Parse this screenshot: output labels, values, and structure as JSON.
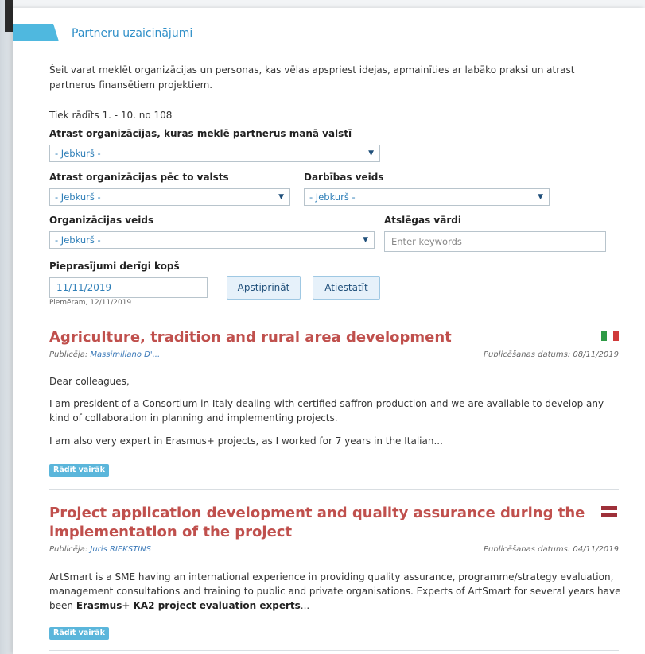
{
  "header": {
    "title": "Partneru uzaicinājumi"
  },
  "intro": "Šeit varat meklēt organizācijas un personas, kas vēlas apspriest idejas, apmainīties ar labāko praksi un atrast partnerus finansētiem projektiem.",
  "count_text": "Tiek rādīts 1. - 10. no 108",
  "filters": {
    "country_partner_label": "Atrast organizācijas, kuras meklē partnerus manā valstī",
    "country_partner_value": "- Jebkurš -",
    "country_label": "Atrast organizācijas pēc to valsts",
    "country_value": "- Jebkurš -",
    "activity_label": "Darbības veids",
    "activity_value": "- Jebkurš -",
    "org_type_label": "Organizācijas veids",
    "org_type_value": "- Jebkurš -",
    "keywords_label": "Atslēgas vārdi",
    "keywords_placeholder": "Enter keywords",
    "valid_since_label": "Pieprasījumi derīgi kopš",
    "valid_since_value": "11/11/2019",
    "date_hint": "Piemēram, 12/11/2019",
    "apply_label": "Apstiprināt",
    "reset_label": "Atiestatīt"
  },
  "posts": [
    {
      "title": "Agriculture, tradition and rural area development",
      "publisher_label": "Publicēja:",
      "publisher": "Massimiliano D'...",
      "date_label": "Publicēšanas datums: 08/11/2019",
      "flag": "italy-flag",
      "p1": "Dear colleagues,",
      "p2": "I am president of a Consortium in Italy dealing with certified saffron production and we are available to develop any kind of collaboration in planning and implementing projects.",
      "p3": "I am also very expert in Erasmus+ projects, as I worked for 7 years in the Italian...",
      "more_label": "Rādīt vairāk"
    },
    {
      "title": "Project application development and quality assurance during the implementation of the project",
      "publisher_label": "Publicēja:",
      "publisher": "Juris RIEKSTINS",
      "date_label": "Publicēšanas datums: 04/11/2019",
      "flag": "latvia-flag",
      "p1_start": "ArtSmart is a SME having an international experience in providing quality assurance, programme/strategy evaluation, management consultations and training to public and private organisations. Experts of ArtSmart for several years have been ",
      "p1_bold": "Erasmus+ KA2 project evaluation experts",
      "p1_end": "...",
      "more_label": "Rādīt vairāk"
    }
  ],
  "colors": {
    "accent": "#4fb8df",
    "title_red": "#c0504d",
    "link": "#2f8fc8"
  }
}
